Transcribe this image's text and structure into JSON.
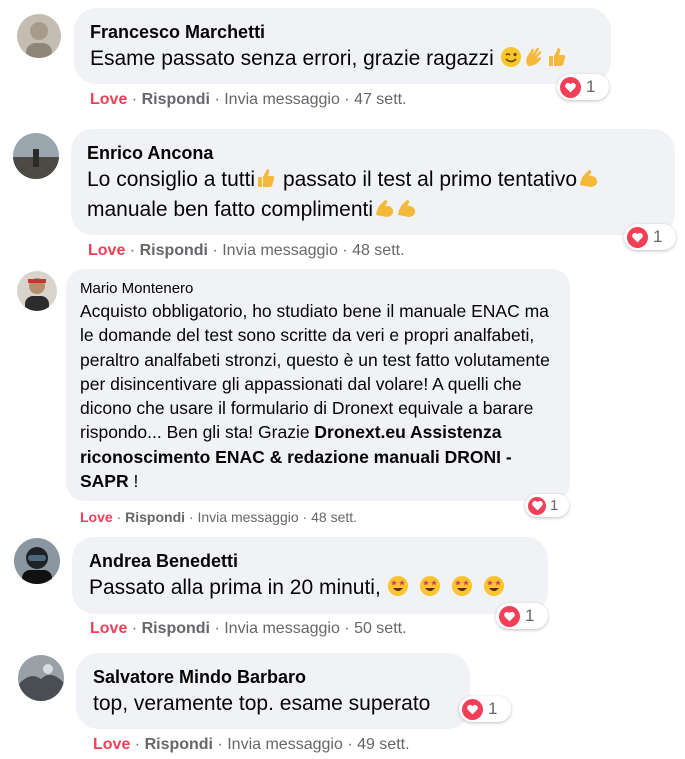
{
  "actions": {
    "love": "Love",
    "reply": "Rispondi",
    "message": "Invia messaggio"
  },
  "comments": [
    {
      "name": "Francesco Marchetti",
      "text": "Esame passato senza errori, grazie ragazzi",
      "time": "47 sett.",
      "reactions": "1",
      "avatar_color": "#b7b0a6"
    },
    {
      "name": "Enrico Ancona",
      "text_1": "Lo consiglio a tutti",
      "text_2": " passato il test al primo tentativo",
      "text_3": "manuale ben fatto complimenti",
      "time": "48 sett.",
      "reactions": "1",
      "avatar_color": "#5a6670"
    },
    {
      "name": "Mario Montenero",
      "text": "Acquisto obbligatorio, ho studiato bene il manuale ENAC ma le domande del test sono scritte da veri e propri analfabeti, peraltro analfabeti stronzi, questo è un test fatto volutamente per disincentivare gli appassionati dal volare! A quelli che dicono che usare il formulario di Dronext equivale a barare rispondo... Ben gli sta! Grazie ",
      "mention": "Dronext.eu Assistenza riconoscimento ENAC & redazione manuali DRONI - SAPR",
      "text_end": " !",
      "time": "48 sett.",
      "reactions": "1",
      "avatar_color": "#c9b59a"
    },
    {
      "name": "Andrea Benedetti",
      "text": "Passato alla prima in 20 minuti, ",
      "time": "50 sett.",
      "reactions": "1",
      "avatar_color": "#3b4148"
    },
    {
      "name": "Salvatore Mindo Barbaro",
      "text": "top, veramente top. esame superato",
      "time": "49 sett.",
      "reactions": "1",
      "avatar_color": "#6b6f75"
    }
  ],
  "colors": {
    "bubble": "#f0f2f5",
    "love": "#f33e58",
    "muted": "#65676b"
  }
}
